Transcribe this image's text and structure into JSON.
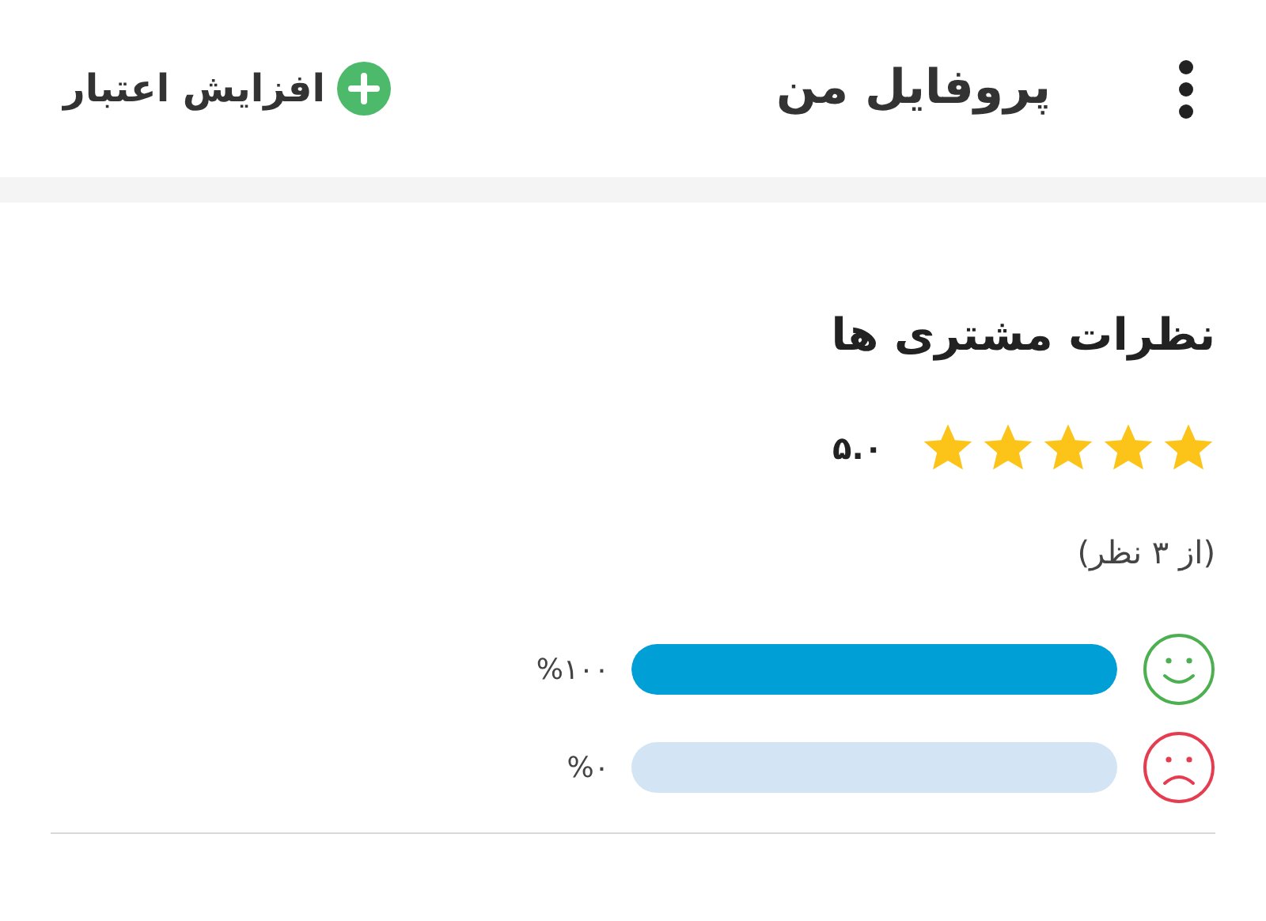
{
  "header": {
    "title": "پروفایل من",
    "credit_button": "افزایش اعتبار"
  },
  "reviews": {
    "title": "نظرات مشتری ها",
    "stars": 5,
    "rating": "۵.۰",
    "count": "(از ۳ نظر)",
    "bars": [
      {
        "kind": "happy",
        "level": 1,
        "reading": "%۱۰۰"
      },
      {
        "kind": "sad",
        "level": 0,
        "reading": "%۰"
      }
    ]
  }
}
